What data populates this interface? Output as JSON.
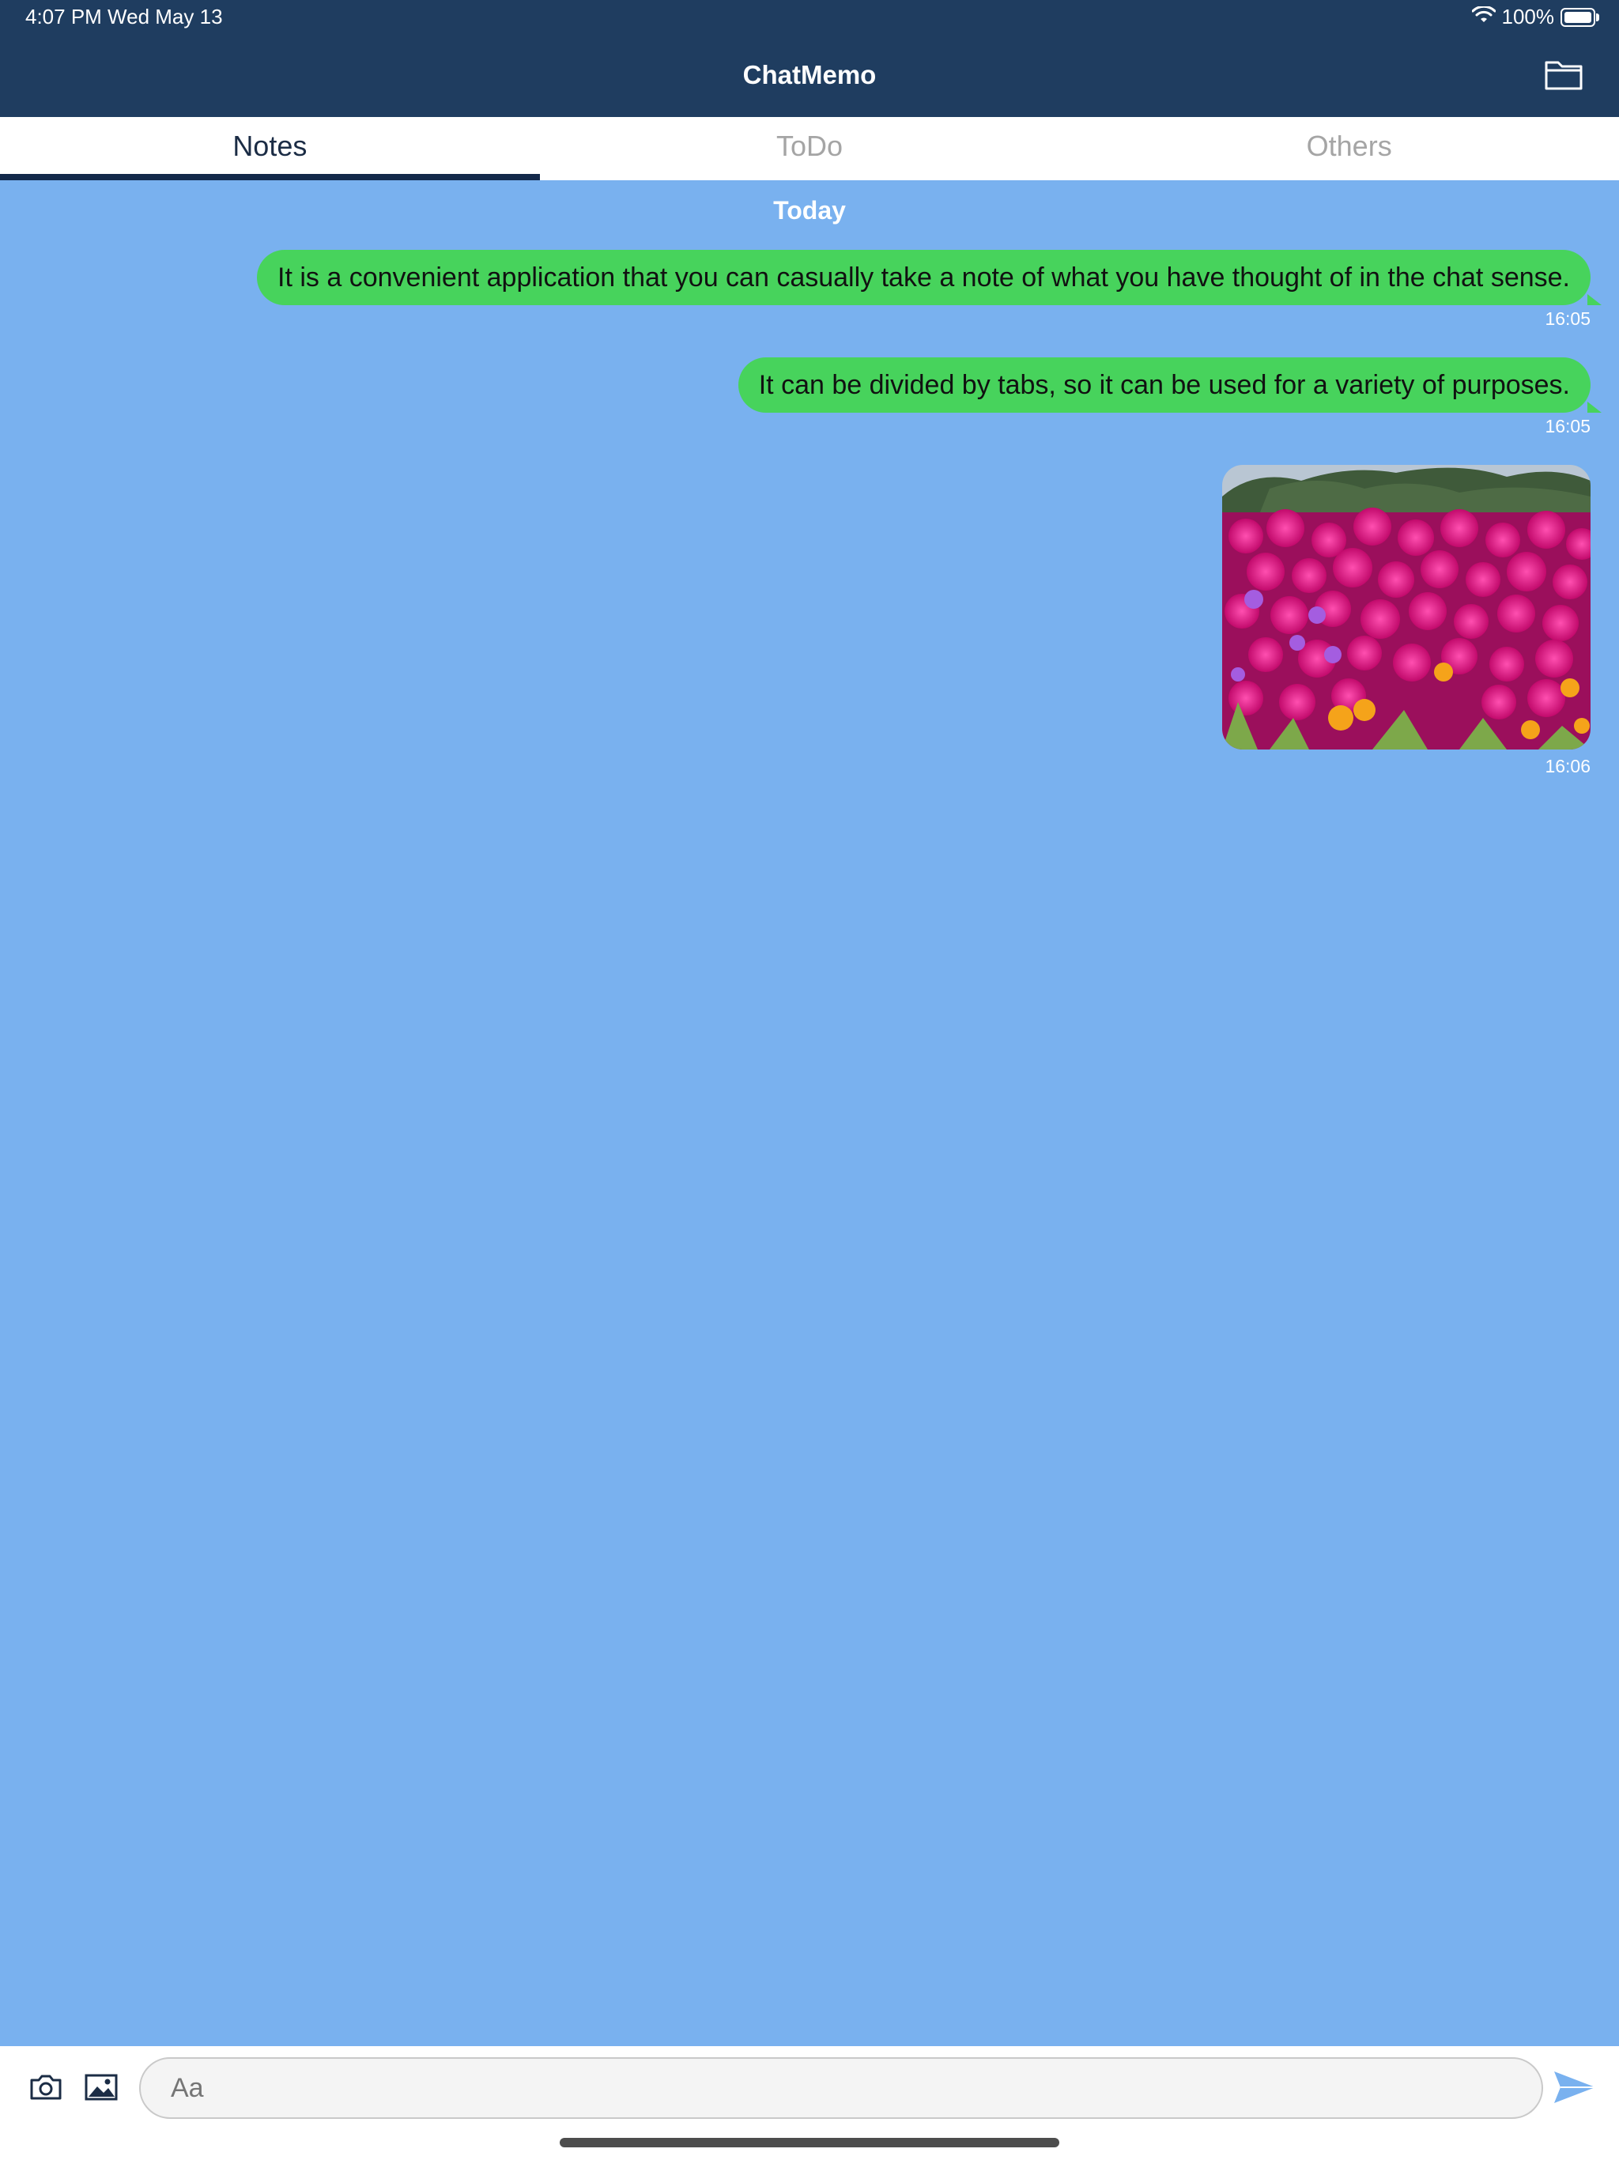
{
  "status_bar": {
    "time_date": "4:07 PM   Wed May 13",
    "battery": "100%",
    "icons": [
      "wifi-icon",
      "battery-icon"
    ]
  },
  "header": {
    "title": "ChatMemo",
    "folder_icon": "folder-icon"
  },
  "tabs": [
    {
      "label": "Notes",
      "active": true
    },
    {
      "label": "ToDo",
      "active": false
    },
    {
      "label": "Others",
      "active": false
    }
  ],
  "chat": {
    "date_label": "Today",
    "messages": [
      {
        "type": "text",
        "text": "It is a convenient application that you can casually take a note of what you have thought of in the chat sense.",
        "time": "16:05"
      },
      {
        "type": "text",
        "text": "It can be divided by tabs, so it can be used for a variety of purposes.",
        "time": "16:05"
      },
      {
        "type": "image",
        "image": "photo of magenta flowers",
        "time": "16:06"
      }
    ]
  },
  "composer": {
    "placeholder": "Aa",
    "icons": [
      "camera-icon",
      "photo-library-icon",
      "send-icon"
    ]
  },
  "colors": {
    "header": "#1f3d60",
    "background": "#79b1ef",
    "bubble": "#47d35c",
    "tab_active": "#13294a"
  }
}
